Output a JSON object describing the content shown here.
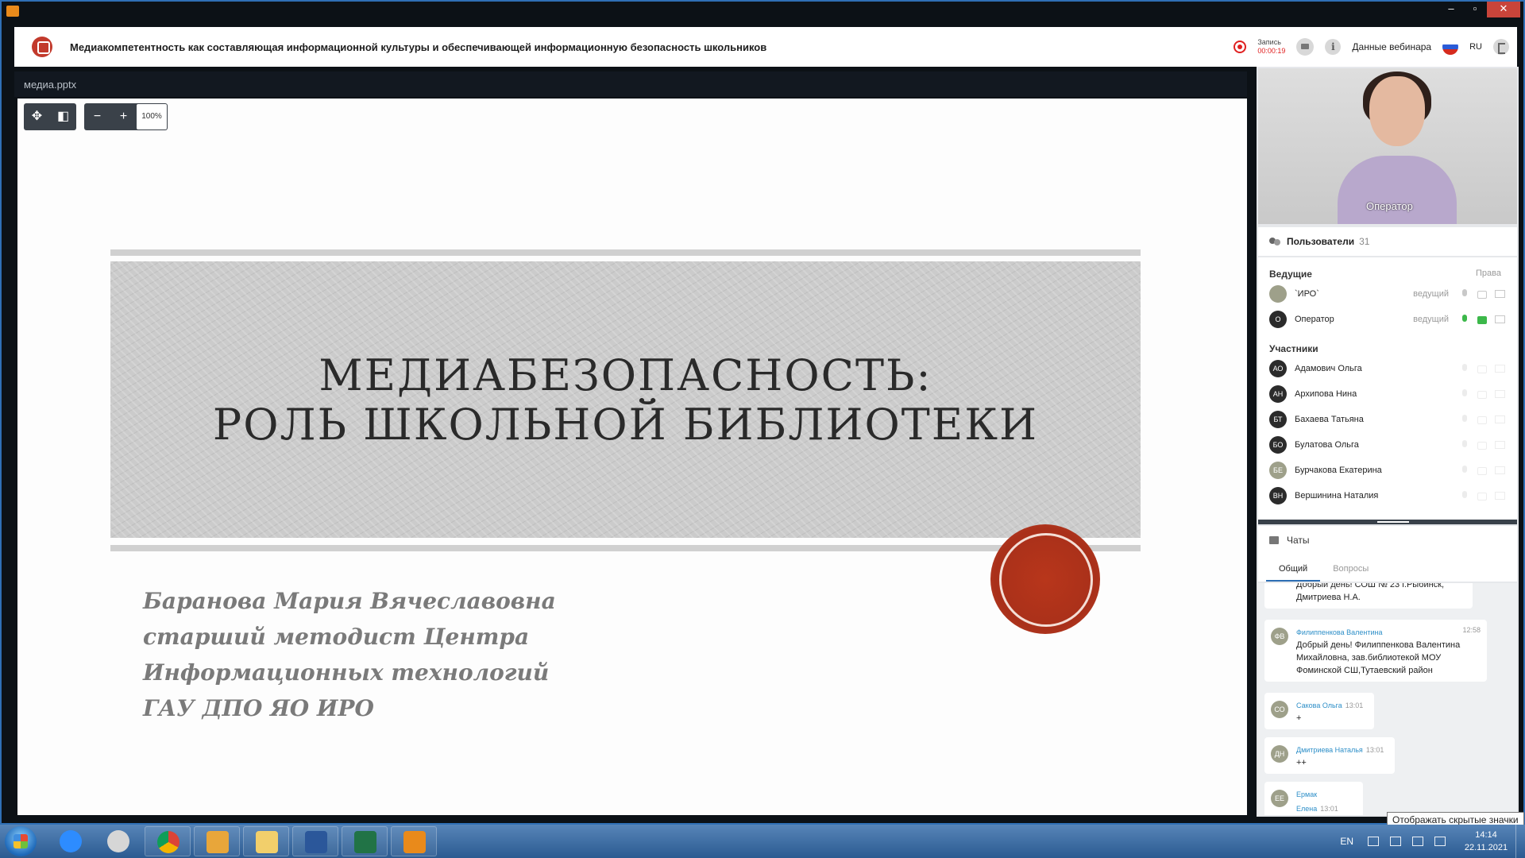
{
  "header": {
    "title": "Медиакомпетентность как составляющая информационной культуры и обеспечивающей информационную безопасность школьников",
    "record_label": "Запись",
    "record_time": "00:00:19",
    "webinar_info_label": "Данные вебинара",
    "lang": "RU"
  },
  "presentation": {
    "file_name": "медиа.pptx",
    "zoom": "100%",
    "slide_title_line1": "МЕДИАБЕЗОПАСНОСТЬ:",
    "slide_title_line2": "РОЛЬ ШКОЛЬНОЙ БИБЛИОТЕКИ",
    "author_lines": [
      "Баранова Мария Вячеславовна",
      "старший методист Центра",
      "Информационных технологий",
      "ГАУ ДПО ЯО ИРО"
    ]
  },
  "video": {
    "label": "Оператор"
  },
  "users": {
    "header": "Пользователи",
    "count": "31",
    "hosts_label": "Ведущие",
    "rights_label": "Права",
    "participants_label": "Участники",
    "hosts": [
      {
        "initials": "",
        "name": "`ИРО`",
        "role": "ведущий"
      },
      {
        "initials": "О",
        "name": "Оператор",
        "role": "ведущий"
      }
    ],
    "participants": [
      {
        "initials": "АО",
        "name": "Адамович Ольга"
      },
      {
        "initials": "АН",
        "name": "Архипова Нина"
      },
      {
        "initials": "БТ",
        "name": "Бахаева Татьяна"
      },
      {
        "initials": "БО",
        "name": "Булатова Ольга"
      },
      {
        "initials": "БЕ",
        "name": "Бурчакова Екатерина"
      },
      {
        "initials": "ВН",
        "name": "Вершинина Наталия"
      }
    ]
  },
  "chats": {
    "header": "Чаты",
    "tabs": [
      "Общий",
      "Вопросы"
    ],
    "messages": [
      {
        "initials": "",
        "author": "",
        "time": "",
        "text": [
          "Добрый день! СОШ № 23 г.Рыбинск,",
          "Дмитриева Н.А."
        ]
      },
      {
        "initials": "ФВ",
        "author": "Филиппенкова Валентина",
        "time": "12:58",
        "text": [
          "Добрый день! Филиппенкова Валентина",
          "Михайловна, зав.библиотекой МОУ",
          "Фоминской СШ,Тутаевский район"
        ]
      },
      {
        "initials": "СО",
        "author": "Сакова Ольга",
        "time": "13:01",
        "text": [
          "+"
        ]
      },
      {
        "initials": "ДН",
        "author": "Дмитриева Наталья",
        "time": "13:01",
        "text": [
          "++"
        ]
      },
      {
        "initials": "ЕЕ",
        "author": "Ермак Елена",
        "time": "13:01",
        "text": [
          "+"
        ]
      }
    ]
  },
  "taskbar": {
    "tooltip": "Отображать скрытые значки",
    "lang": "EN",
    "time": "14:14",
    "date": "22.11.2021"
  },
  "colors": {
    "record_red": "#e02020",
    "chat_author_blue": "#2e8fc8",
    "seal_red": "#b8361b",
    "active_green": "#3cb84a"
  }
}
